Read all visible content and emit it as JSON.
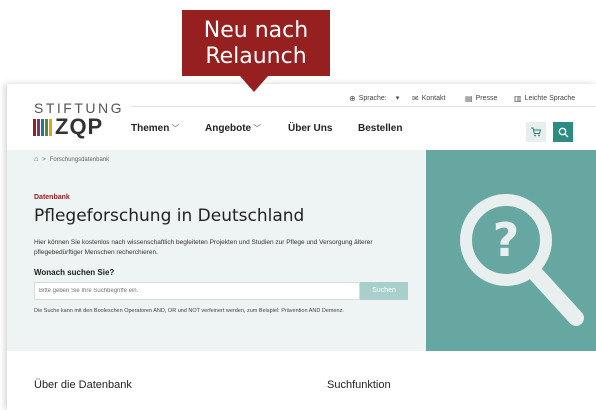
{
  "callout": {
    "line1": "Neu nach",
    "line2": "Relaunch"
  },
  "logo": {
    "top": "STIFTUNG",
    "bottom": "ZQP",
    "bar_colors": [
      "#962020",
      "#6e3b6e",
      "#2e6f9a",
      "#4f8b3a",
      "#e0a21b"
    ]
  },
  "utility_nav": {
    "language": "Sprache:",
    "language_value": "▾",
    "contact": "Kontakt",
    "press": "Presse",
    "easy_language": "Leichte Sprache"
  },
  "main_nav": [
    {
      "label": "Themen",
      "has_dropdown": true
    },
    {
      "label": "Angebote",
      "has_dropdown": true
    },
    {
      "label": "Über Uns",
      "has_dropdown": false
    },
    {
      "label": "Bestellen",
      "has_dropdown": false
    }
  ],
  "breadcrumb": {
    "home_icon": "home-icon",
    "current": "Forschungsdatenbank"
  },
  "hero": {
    "kicker": "Datenbank",
    "title": "Pflegeforschung in Deutschland",
    "description": "Hier können Sie kostenlos nach wissenschaftlich begleiteten Projekten und Studien zur Pflege und Versorgung älterer pflegebedürftiger Menschen recherchieren.",
    "search_label": "Wonach suchen Sie?",
    "search_placeholder": "Bitte geben Sie Ihre Suchbegriffe ein.",
    "search_button": "Suchen",
    "hint": "Die Suche kann mit den Booleschen Operatoren AND, OR und NOT verfeinert werden, zum Beispiel: Prävention AND Demenz."
  },
  "sections": {
    "left": "Über die Datenbank",
    "right": "Suchfunktion"
  },
  "colors": {
    "brand_red": "#962020",
    "teal": "#2e8b82",
    "hero_bg": "#eef4f3",
    "art_bg": "#66a7a1"
  }
}
